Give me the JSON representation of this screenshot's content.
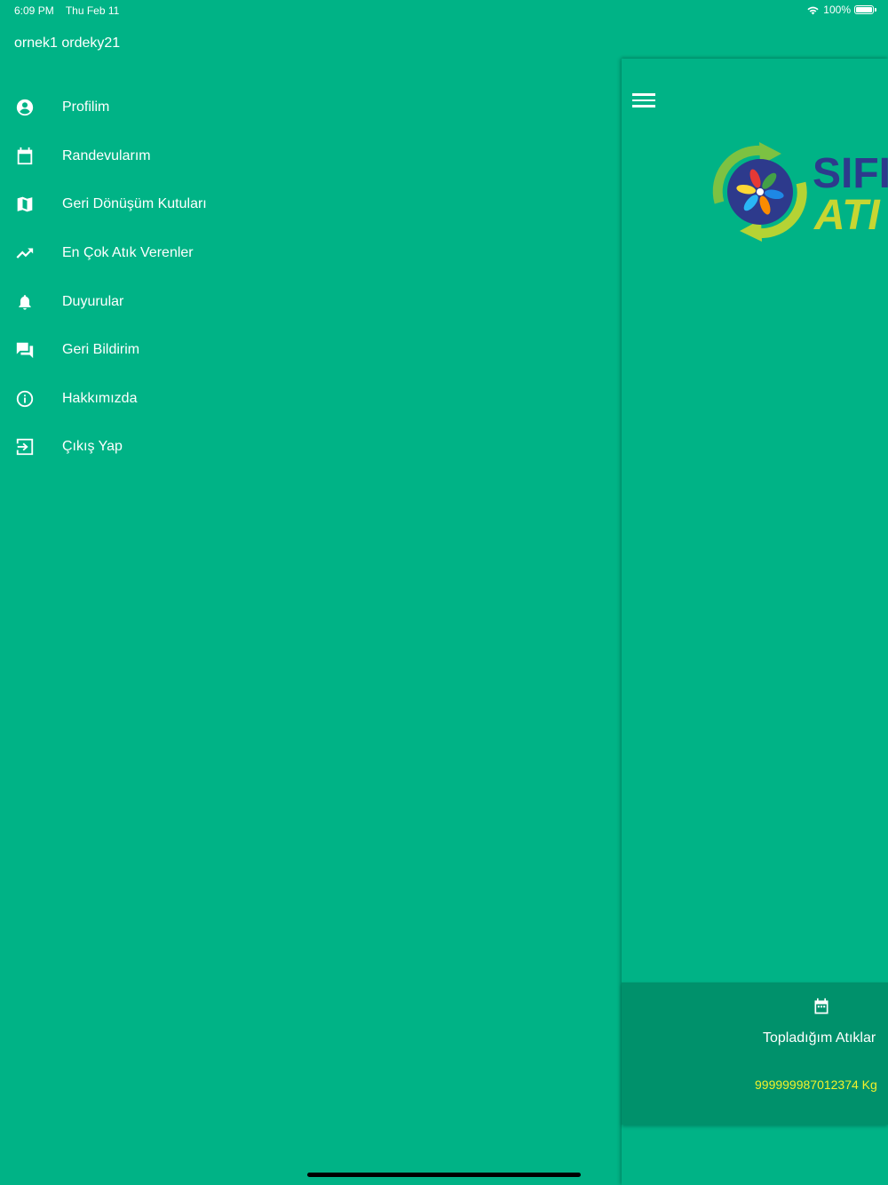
{
  "status_bar": {
    "time": "6:09 PM",
    "date": "Thu Feb 11",
    "battery": "100%"
  },
  "drawer": {
    "user_name": "ornek1 ordeky21",
    "items": [
      {
        "label": "Profilim",
        "icon": "account-circle-icon"
      },
      {
        "label": "Randevularım",
        "icon": "calendar-icon"
      },
      {
        "label": "Geri Dönüşüm Kutuları",
        "icon": "map-icon"
      },
      {
        "label": "En Çok Atık Verenler",
        "icon": "trending-up-icon"
      },
      {
        "label": "Duyurular",
        "icon": "bell-icon"
      },
      {
        "label": "Geri Bildirim",
        "icon": "chat-icon"
      },
      {
        "label": "Hakkımızda",
        "icon": "info-icon"
      },
      {
        "label": "Çıkış Yap",
        "icon": "logout-icon"
      }
    ]
  },
  "main": {
    "logo": {
      "line1": "SIFI",
      "line2": "ATI"
    },
    "stats_card": {
      "title": "Topladığım Atıklar",
      "value": "999999987012374 Kg"
    }
  },
  "colors": {
    "background": "#00b386",
    "card": "#00916b",
    "value": "#f2f22a"
  }
}
